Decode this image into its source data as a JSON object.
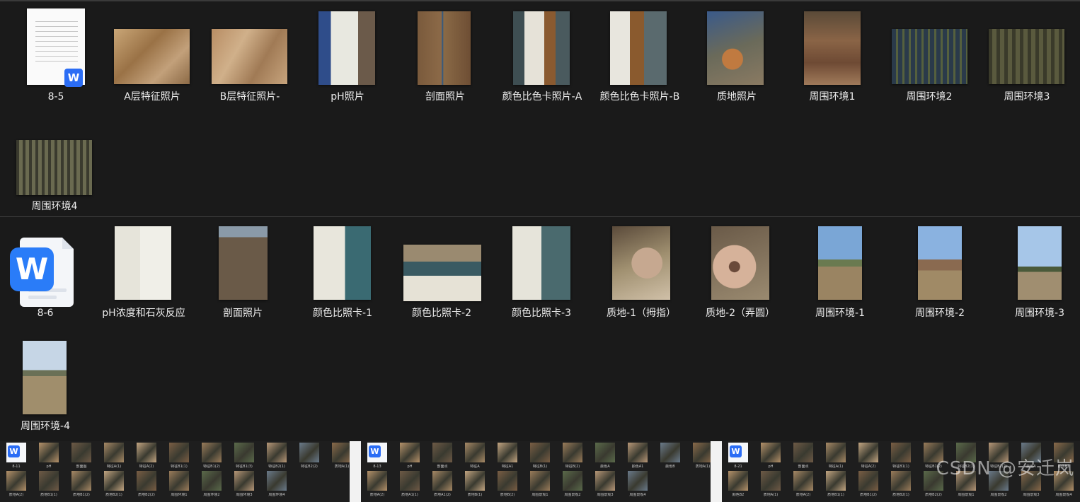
{
  "section1": {
    "items": [
      {
        "label": "8-5",
        "type": "doc"
      },
      {
        "label": "A层特征照片",
        "type": "image",
        "color": "#b58f5e"
      },
      {
        "label": "B层特征照片-",
        "type": "image",
        "color": "#b48a62"
      },
      {
        "label": "pH照片",
        "type": "image",
        "color": "#5a6b7a"
      },
      {
        "label": "剖面照片",
        "type": "image",
        "color": "#7a5a3e"
      },
      {
        "label": "颜色比色卡照片-A",
        "type": "image",
        "color": "#4a5a5e"
      },
      {
        "label": "颜色比色卡照片-B",
        "type": "image",
        "color": "#5b6a6e"
      },
      {
        "label": "质地照片",
        "type": "image",
        "color": "#7a6a5a"
      },
      {
        "label": "周围环境1",
        "type": "image",
        "color": "#6d4c3a"
      },
      {
        "label": "周围环境2",
        "type": "image",
        "color": "#3e4a30"
      },
      {
        "label": "周围环境3",
        "type": "image",
        "color": "#4a4838"
      },
      {
        "label": "周围环境4",
        "type": "image",
        "color": "#44483a"
      }
    ]
  },
  "section2": {
    "items": [
      {
        "label": "8-6",
        "type": "wps"
      },
      {
        "label": "pH浓度和石灰反应",
        "type": "image",
        "color": "#9a8a6a"
      },
      {
        "label": "剖面照片",
        "type": "image",
        "color": "#6a5a48"
      },
      {
        "label": "颜色比照卡-1",
        "type": "image",
        "color": "#8a7a68"
      },
      {
        "label": "颜色比照卡-2",
        "type": "image",
        "color": "#7e7060"
      },
      {
        "label": "颜色比照卡-3",
        "type": "image",
        "color": "#857565"
      },
      {
        "label": "质地-1（拇指）",
        "type": "image",
        "color": "#a0907c"
      },
      {
        "label": "质地-2（弄圆）",
        "type": "image",
        "color": "#8a6f5e"
      },
      {
        "label": "周围环境-1",
        "type": "image",
        "color": "#8d8466"
      },
      {
        "label": "周围环境-2",
        "type": "image",
        "color": "#8d8065"
      },
      {
        "label": "周围环境-3",
        "type": "image",
        "color": "#9a8f70"
      },
      {
        "label": "周围环境-4",
        "type": "image",
        "color": "#9c8e6e"
      }
    ]
  },
  "strip": {
    "group1": [
      "8-11",
      "pH",
      "剖面图",
      "特征A(1)",
      "特征A(2)",
      "特征B1(1)",
      "特征B1(2)",
      "特征B1(3)",
      "特征B2(1)",
      "特征B2(2)",
      "质地A(1)",
      "质地A(2)",
      "质地B1(1)",
      "质地B1(2)",
      "质地B2(1)",
      "质地B2(2)",
      "周围环境1",
      "周围环境2",
      "周围环境3",
      "周围环境4"
    ],
    "group2": [
      "8-13",
      "pH",
      "剖面点",
      "特征A",
      "特征A1",
      "特征B(1)",
      "特征B(2)",
      "颜色A",
      "颜色A1",
      "颜色B",
      "质地A(1)",
      "质地A(2)",
      "质地A1(1)",
      "质地A1(2)",
      "质地B(1)",
      "质地B(2)",
      "周围景观1",
      "周围景观2",
      "周围景观3",
      "周围景观4"
    ],
    "group3": [
      "8-21",
      "pH",
      "剖面点",
      "特征A(1)",
      "特征A(2)",
      "特征B1(1)",
      "特征B1(2)",
      "特征B2(1)",
      "特征B2(2)",
      "颜色A",
      "颜色B1",
      "颜色B2",
      "质地A(1)",
      "质地A(2)",
      "质地B1(1)",
      "质地B1(2)",
      "质地B2(1)",
      "质地B2(2)",
      "周围景观1",
      "周围景观2",
      "周围景观3",
      "周围景观4"
    ]
  },
  "watermark": "CSDN @安迁岚",
  "badge_letter": "W"
}
